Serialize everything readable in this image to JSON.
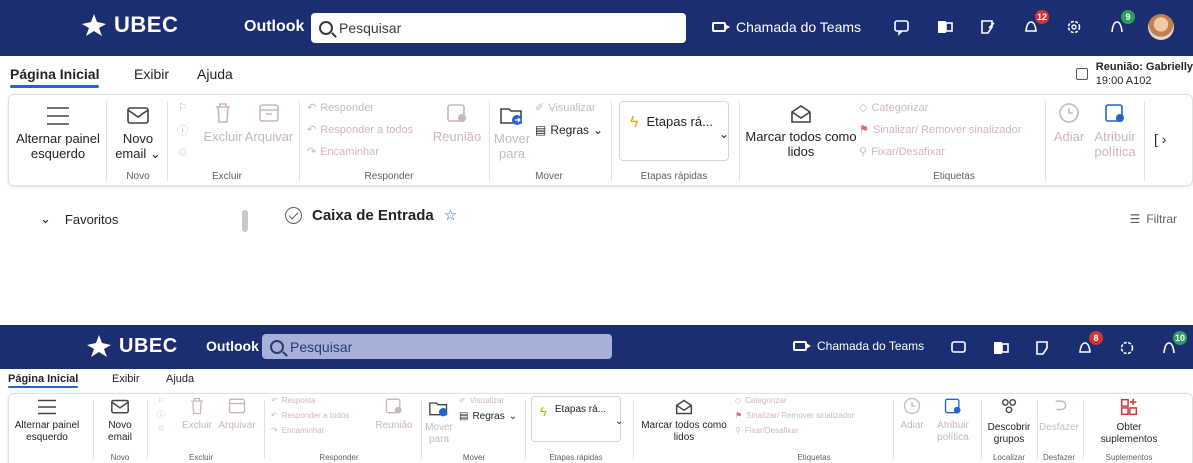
{
  "colors": {
    "brand_bar": "#1b2e72",
    "accent": "#2564cf",
    "badge": "#d13438",
    "disabled_text": "#c9b7bf"
  },
  "screens": [
    {
      "header": {
        "logo_text": "UBEC",
        "app_name": "Outlook",
        "search_placeholder": "Pesquisar",
        "teams_label": "Chamada do Teams",
        "icons": [
          "chat-icon",
          "office-icon",
          "feedback-icon",
          "notifications-icon",
          "settings-icon",
          "tips-icon"
        ],
        "badges": {
          "notifications": "12",
          "tips": "9"
        }
      },
      "tabs": [
        "Página Inicial",
        "Exibir",
        "Ajuda"
      ],
      "meeting": {
        "title": "Reunião: Gabrielly",
        "time": "19:00 A102"
      },
      "ribbon": {
        "toggle_pane": "Alternar painel esquerdo",
        "new_email": "Novo email",
        "group_new": "Novo",
        "delete": "Excluir",
        "archive": "Arquivar",
        "group_delete": "Excluir",
        "reply": "Responder",
        "reply_all": "Responder a todos",
        "forward": "Encaminhar",
        "meeting": "Reunião",
        "group_reply": "Responder",
        "move_to": "Mover para",
        "view": "Visualizar",
        "rules": "Regras",
        "group_move": "Mover",
        "quick_steps": "Etapas rá...",
        "group_quick": "Etapas rápidas",
        "mark_all_read": "Marcar todos como lidos",
        "categorize": "Categorizar",
        "flag": "Sinalizar/ Remover sinalizador",
        "pin": "Fixar/Desafixar",
        "group_tags": "Etiquetas",
        "snooze": "Adiar",
        "policy": "Atribuir política"
      },
      "mail": {
        "favorites": "Favoritos",
        "inbox": "Caixa de Entrada",
        "filter": "Filtrar"
      }
    },
    {
      "header": {
        "logo_text": "UBEC",
        "app_name": "Outlook",
        "search_placeholder": "Pesquisar",
        "teams_label": "Chamada do Teams",
        "badges": {
          "notifications": "8",
          "tips": "10"
        }
      },
      "tabs": [
        "Página Inicial",
        "Exibir",
        "Ajuda"
      ],
      "ribbon": {
        "toggle_pane": "Alternar painel esquerdo",
        "new_email": "Novo email",
        "group_new": "Novo",
        "delete": "Excluir",
        "archive": "Arquivar",
        "group_delete": "Excluir",
        "reply": "Resposta",
        "reply_all": "Responder a todos",
        "forward": "Encaminhar",
        "meeting": "Reunião",
        "group_reply": "Responder",
        "move_to": "Mover para",
        "view": "Visualizar",
        "rules": "Regras",
        "group_move": "Mover",
        "quick_steps": "Etapas rá...",
        "group_quick": "Etapas rápidas",
        "mark_all_read": "Marcar todos como lidos",
        "categorize": "Categorizar",
        "flag": "Sinalizar/ Remover sinalizador",
        "pin": "Fixar/Desafixar",
        "group_tags": "Etiquetas",
        "snooze": "Adiar",
        "policy": "Atribuir política",
        "discover_groups": "Descobrir grupos",
        "group_find": "Localizar",
        "undo": "Desfazer",
        "group_undo": "Desfazer",
        "get_addins": "Obter suplementos",
        "group_addins": "Suplementos"
      }
    }
  ]
}
